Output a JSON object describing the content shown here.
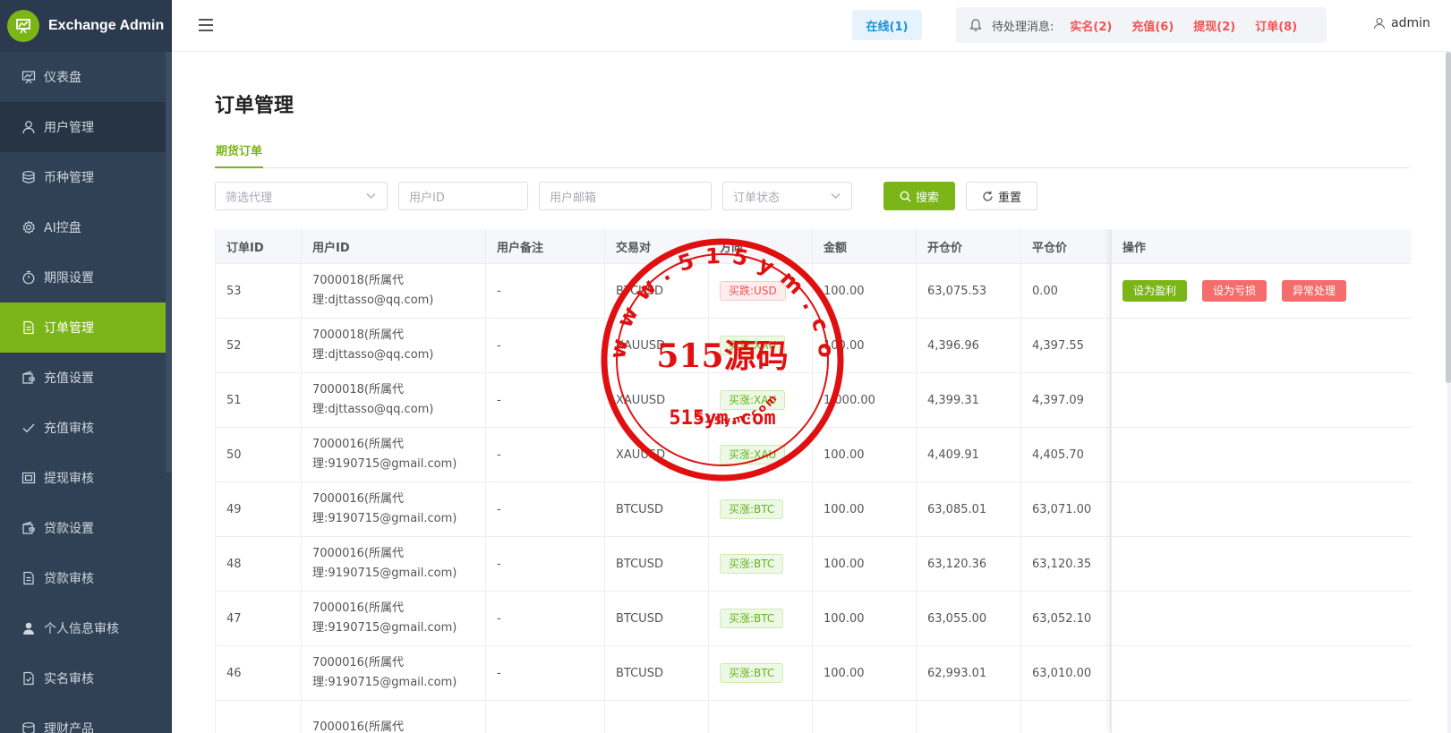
{
  "app": {
    "title": "Exchange Admin"
  },
  "sidebar": {
    "items": [
      {
        "label": "仪表盘",
        "icon": "dashboard-icon"
      },
      {
        "label": "用户管理",
        "icon": "user-icon"
      },
      {
        "label": "币种管理",
        "icon": "coin-icon"
      },
      {
        "label": "AI控盘",
        "icon": "gear-icon"
      },
      {
        "label": "期限设置",
        "icon": "timer-icon"
      },
      {
        "label": "订单管理",
        "icon": "document-icon"
      },
      {
        "label": "充值设置",
        "icon": "wallet-icon"
      },
      {
        "label": "充值审核",
        "icon": "check-icon"
      },
      {
        "label": "提现审核",
        "icon": "withdraw-icon"
      },
      {
        "label": "贷款设置",
        "icon": "wallet-icon"
      },
      {
        "label": "贷款审核",
        "icon": "document-icon"
      },
      {
        "label": "个人信息审核",
        "icon": "person-icon"
      },
      {
        "label": "实名审核",
        "icon": "document-check-icon"
      },
      {
        "label": "理财产品",
        "icon": "database-icon"
      }
    ]
  },
  "header": {
    "online": "在线(1)",
    "pending_label": "待处理消息:",
    "pending": [
      "实名(2)",
      "充值(6)",
      "提现(2)",
      "订单(8)"
    ],
    "user": "admin"
  },
  "page": {
    "title": "订单管理",
    "tab": "期货订单"
  },
  "filters": {
    "agent_placeholder": "筛选代理",
    "uid_placeholder": "用户ID",
    "email_placeholder": "用户邮箱",
    "status_placeholder": "订单状态",
    "search_label": "搜索",
    "reset_label": "重置"
  },
  "table": {
    "headers": [
      "订单ID",
      "用户ID",
      "用户备注",
      "交易对",
      "方向",
      "金额",
      "开仓价",
      "平仓价"
    ],
    "actions_header": "操作",
    "rows": [
      {
        "id": "53",
        "uid1": "7000018(所属代",
        "uid2": "理:djttasso@qq.com)",
        "note": "-",
        "pair": "BTCUSD",
        "dir": "买跌:USD",
        "dir_type": "down",
        "amount": "100.00",
        "open": "63,075.53",
        "close": "0.00"
      },
      {
        "id": "52",
        "uid1": "7000018(所属代",
        "uid2": "理:djttasso@qq.com)",
        "note": "-",
        "pair": "XAUUSD",
        "dir": "买涨:XAU",
        "dir_type": "up",
        "amount": "100.00",
        "open": "4,396.96",
        "close": "4,397.55"
      },
      {
        "id": "51",
        "uid1": "7000018(所属代",
        "uid2": "理:djttasso@qq.com)",
        "note": "-",
        "pair": "XAUUSD",
        "dir": "买涨:XAU",
        "dir_type": "up",
        "amount": "1,000.00",
        "open": "4,399.31",
        "close": "4,397.09"
      },
      {
        "id": "50",
        "uid1": "7000016(所属代",
        "uid2": "理:9190715@gmail.com)",
        "note": "-",
        "pair": "XAUUSD",
        "dir": "买涨:XAU",
        "dir_type": "up",
        "amount": "100.00",
        "open": "4,409.91",
        "close": "4,405.70"
      },
      {
        "id": "49",
        "uid1": "7000016(所属代",
        "uid2": "理:9190715@gmail.com)",
        "note": "-",
        "pair": "BTCUSD",
        "dir": "买涨:BTC",
        "dir_type": "up",
        "amount": "100.00",
        "open": "63,085.01",
        "close": "63,071.00"
      },
      {
        "id": "48",
        "uid1": "7000016(所属代",
        "uid2": "理:9190715@gmail.com)",
        "note": "-",
        "pair": "BTCUSD",
        "dir": "买涨:BTC",
        "dir_type": "up",
        "amount": "100.00",
        "open": "63,120.36",
        "close": "63,120.35"
      },
      {
        "id": "47",
        "uid1": "7000016(所属代",
        "uid2": "理:9190715@gmail.com)",
        "note": "-",
        "pair": "BTCUSD",
        "dir": "买涨:BTC",
        "dir_type": "up",
        "amount": "100.00",
        "open": "63,055.00",
        "close": "63,052.10"
      },
      {
        "id": "46",
        "uid1": "7000016(所属代",
        "uid2": "理:9190715@gmail.com)",
        "note": "-",
        "pair": "BTCUSD",
        "dir": "买涨:BTC",
        "dir_type": "up",
        "amount": "100.00",
        "open": "62,993.01",
        "close": "63,010.00"
      },
      {
        "id": "",
        "uid1": "7000016(所属代",
        "uid2": "",
        "note": "",
        "pair": "",
        "dir": "",
        "dir_type": "",
        "amount": "",
        "open": "",
        "close": ""
      }
    ],
    "row_actions": [
      "设为盈利",
      "设为亏损",
      "异常处理"
    ]
  },
  "watermark": {
    "center": "515源码",
    "bottom": "515ym.com",
    "ring_top": "www.515ym.com",
    "ring_bottom": "515ym.com"
  },
  "colors": {
    "accent": "#7cb518",
    "sidebar": "#304156",
    "danger": "#f25353"
  }
}
